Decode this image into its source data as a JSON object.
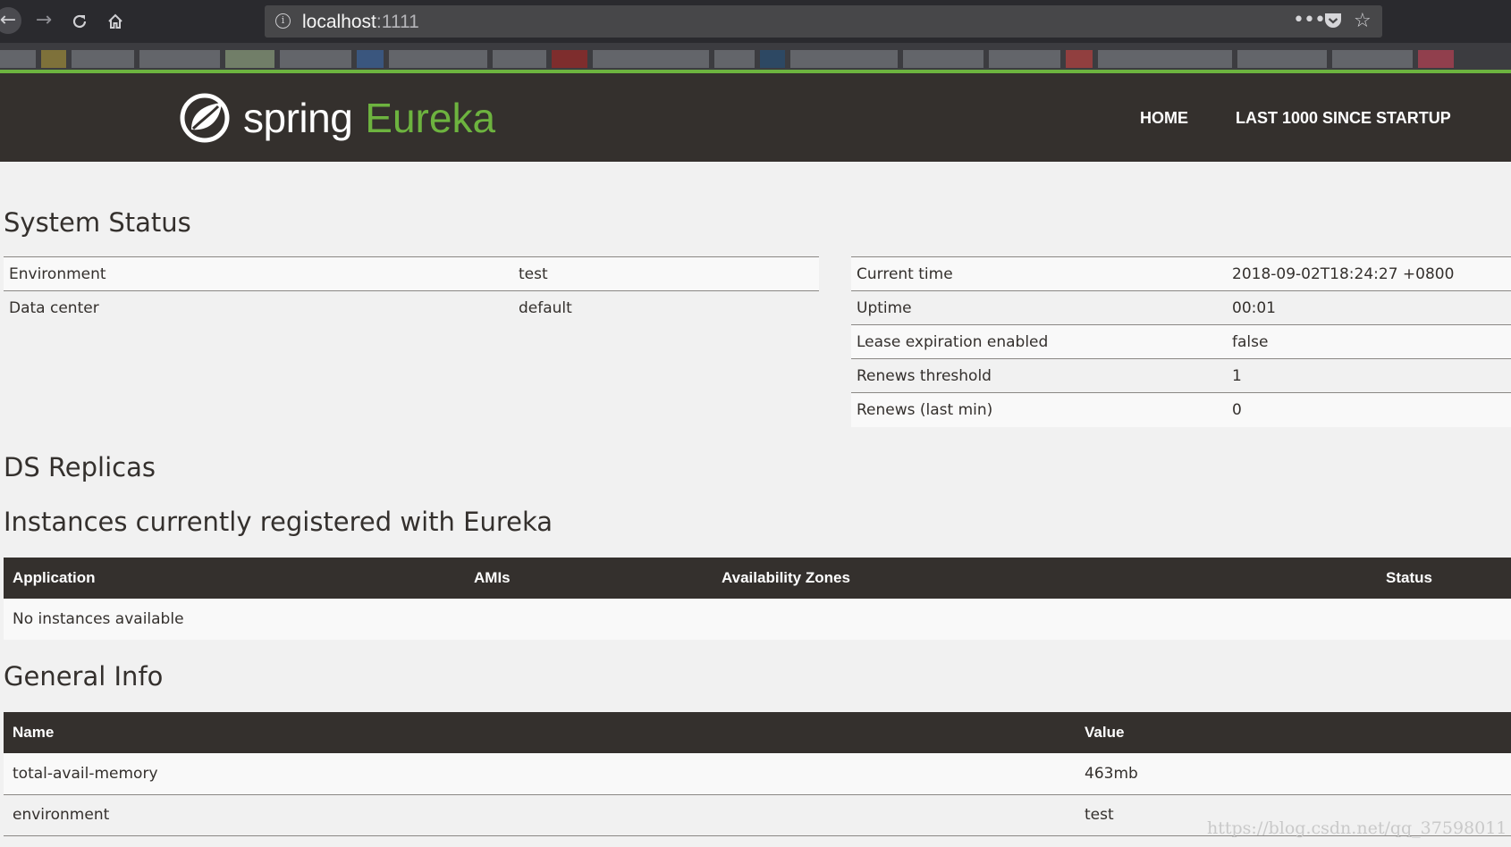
{
  "browser": {
    "url_host": "localhost",
    "url_port": ":1111",
    "more_label": "•••"
  },
  "header": {
    "logo_spring": "spring",
    "logo_eureka": "Eureka",
    "nav_home": "HOME",
    "nav_last": "LAST 1000 SINCE STARTUP",
    "brand_color": "#6db33f",
    "bg_color": "#34302d"
  },
  "system_status": {
    "title": "System Status",
    "left": [
      {
        "label": "Environment",
        "value": "test"
      },
      {
        "label": "Data center",
        "value": "default"
      }
    ],
    "right": [
      {
        "label": "Current time",
        "value": "2018-09-02T18:24:27 +0800"
      },
      {
        "label": "Uptime",
        "value": "00:01"
      },
      {
        "label": "Lease expiration enabled",
        "value": "false"
      },
      {
        "label": "Renews threshold",
        "value": "1"
      },
      {
        "label": "Renews (last min)",
        "value": "0"
      }
    ]
  },
  "ds_replicas": {
    "title": "DS Replicas"
  },
  "instances": {
    "title": "Instances currently registered with Eureka",
    "headers": [
      "Application",
      "AMIs",
      "Availability Zones",
      "Status"
    ],
    "empty_text": "No instances available"
  },
  "general_info": {
    "title": "General Info",
    "headers": [
      "Name",
      "Value"
    ],
    "rows": [
      {
        "name": "total-avail-memory",
        "value": "463mb"
      },
      {
        "name": "environment",
        "value": "test"
      }
    ]
  },
  "watermark": "https://blog.csdn.net/qq_37598011"
}
